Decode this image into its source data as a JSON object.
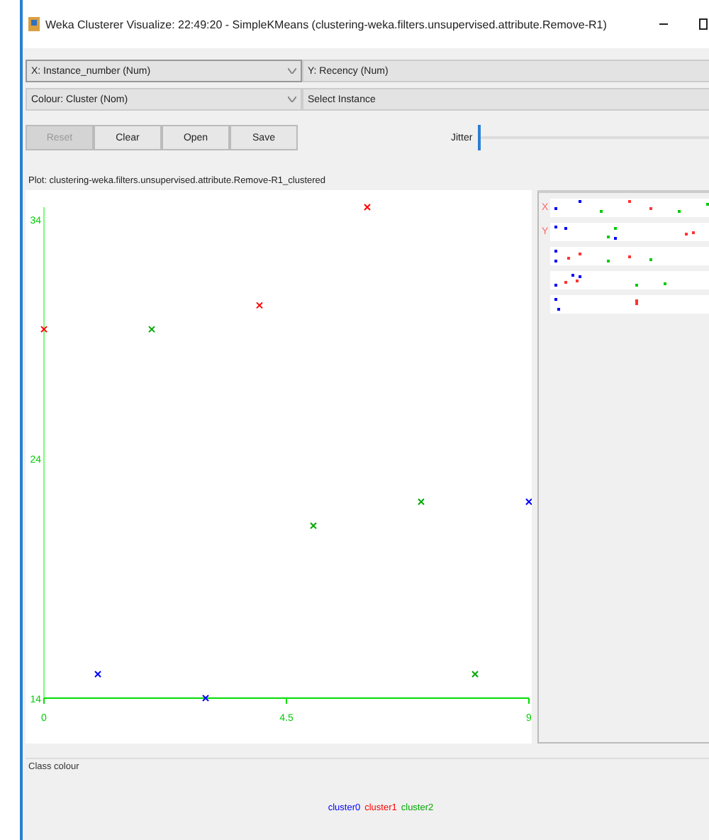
{
  "window": {
    "title": "Weka Clusterer Visualize: 22:49:20 - SimpleKMeans (clustering-weka.filters.unsupervised.attribute.Remove-R1)"
  },
  "selectors": [
    {
      "label": "X: Instance_number (Num)",
      "focused": true
    },
    {
      "label": "Y: Recency (Num)",
      "focused": false
    },
    {
      "label": "Colour: Cluster (Nom)",
      "focused": false
    },
    {
      "label": "Select Instance",
      "focused": false
    }
  ],
  "buttons": [
    {
      "label": "Reset",
      "disabled": true
    },
    {
      "label": "Clear",
      "disabled": false
    },
    {
      "label": "Open",
      "disabled": false
    },
    {
      "label": "Save",
      "disabled": false
    }
  ],
  "jitter": {
    "label": "Jitter",
    "level": 0
  },
  "plot": {
    "title": "Plot: clustering-weka.filters.unsupervised.attribute.Remove-R1_clustered",
    "chart_data": {
      "type": "scatter",
      "x": [
        0,
        1,
        2,
        3,
        4,
        5,
        6,
        7,
        8,
        9
      ],
      "xlim": [
        0,
        9
      ],
      "ylim": [
        14,
        34.5
      ],
      "xticks": [
        0,
        4.5,
        9
      ],
      "yticks": [
        14,
        24,
        34
      ],
      "series": [
        {
          "name": "cluster0",
          "color": "#0000ff",
          "values": [
            null,
            15,
            null,
            14,
            null,
            null,
            null,
            null,
            null,
            22.2
          ]
        },
        {
          "name": "cluster1",
          "color": "#ff0000",
          "values": [
            29.4,
            null,
            null,
            null,
            30.4,
            null,
            34.5,
            null,
            null,
            null
          ]
        },
        {
          "name": "cluster2",
          "color": "#00a800",
          "values": [
            null,
            null,
            29.4,
            null,
            null,
            21.2,
            null,
            22.2,
            15,
            null
          ]
        }
      ]
    }
  },
  "matrix_labels": [
    {
      "label": "X"
    },
    {
      "label": "Y"
    }
  ],
  "class_colour": {
    "title": "Class colour"
  }
}
